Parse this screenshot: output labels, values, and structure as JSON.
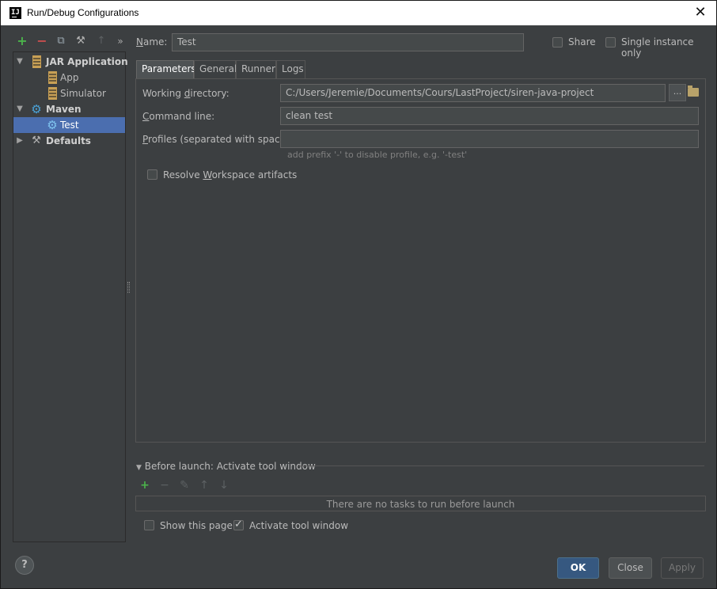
{
  "window": {
    "title": "Run/Debug Configurations",
    "app_icon": "intellij-icon",
    "close": "✕"
  },
  "toolbar": [
    {
      "icon": "add-icon",
      "glyph": "+"
    },
    {
      "icon": "remove-icon",
      "glyph": "−"
    },
    {
      "icon": "copy-icon",
      "glyph": "⧉"
    },
    {
      "icon": "wrench-icon",
      "glyph": "⚒"
    },
    {
      "icon": "move-up-icon",
      "glyph": "↑"
    },
    {
      "icon": "more-icon",
      "glyph": "»"
    }
  ],
  "tree": {
    "jar_application": "JAR Application",
    "app": "App",
    "simulator": "Simulator",
    "maven": "Maven",
    "test": "Test",
    "defaults": "Defaults"
  },
  "name": {
    "label": "Name:",
    "value": "Test"
  },
  "share": {
    "label": "Share",
    "checked": false
  },
  "single_instance": {
    "label": "Single instance only",
    "checked": false
  },
  "tabs": [
    "Parameters",
    "General",
    "Runner",
    "Logs"
  ],
  "parameters": {
    "working_directory_label": "Working directory:",
    "working_directory_value": "C:/Users/Jeremie/Documents/Cours/LastProject/siren-java-project",
    "browse_label": "...",
    "command_line_label": "Command line:",
    "command_line_value": "clean test",
    "profiles_label": "Profiles (separated with space):",
    "profiles_value": "",
    "profiles_hint": "add prefix '-' to disable profile, e.g. '-test'",
    "resolve_label": "Resolve Workspace artifacts",
    "resolve_checked": false
  },
  "before_launch": {
    "title": "Before launch: Activate tool window",
    "empty_text": "There are no tasks to run before launch",
    "show_page_label": "Show this page",
    "show_page_checked": false,
    "activate_label": "Activate tool window",
    "activate_checked": true
  },
  "buttons": {
    "help": "?",
    "ok": "OK",
    "close": "Close",
    "apply": "Apply"
  },
  "colors": {
    "background": "#3c3f41",
    "selection": "#4b6eaf",
    "primary_button": "#365880",
    "add_green": "#4bb34b",
    "remove_red": "#c94f4f"
  }
}
